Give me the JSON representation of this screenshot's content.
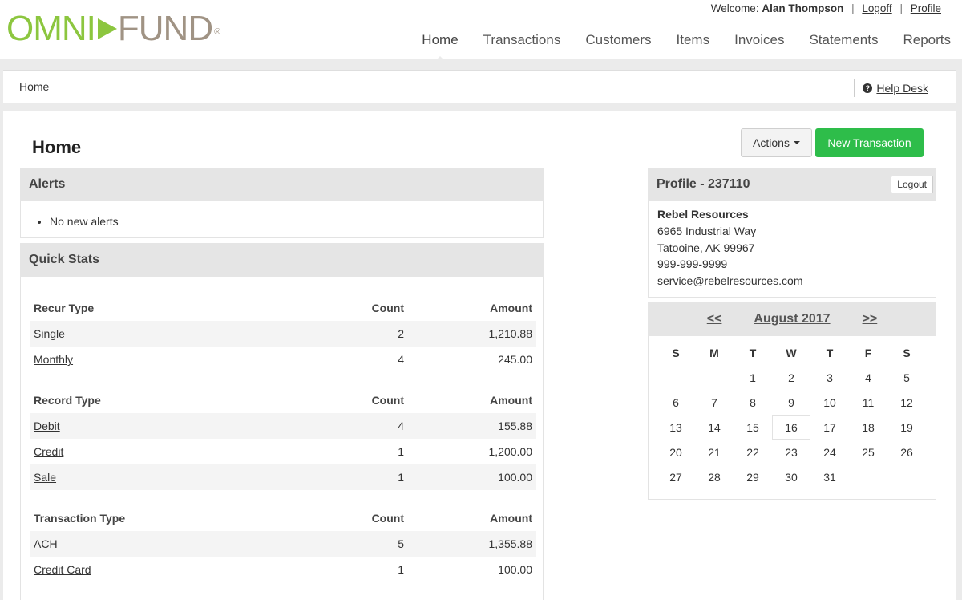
{
  "brand": {
    "left": "OMNI",
    "right": "FUND",
    "reg": "®"
  },
  "user": {
    "welcome": "Welcome:",
    "name": "Alan Thompson",
    "logoff": "Logoff",
    "profile": "Profile",
    "sep": "|"
  },
  "nav": [
    "Home",
    "Transactions",
    "Customers",
    "Items",
    "Invoices",
    "Statements",
    "Reports"
  ],
  "breadcrumb": "Home",
  "help": {
    "icon": "question-circle-icon",
    "label": "Help Desk"
  },
  "page": {
    "title": "Home",
    "actions_label": "Actions",
    "new_label": "New Transaction",
    "new_color": "#2ebd4a"
  },
  "alerts": {
    "title": "Alerts",
    "items": [
      "No new alerts"
    ]
  },
  "quick_stats": {
    "title": "Quick Stats",
    "sections": [
      {
        "header": "Recur Type",
        "count": "Count",
        "amount": "Amount",
        "rows": [
          {
            "label": "Single",
            "count": "2",
            "amount": "1,210.88"
          },
          {
            "label": "Monthly",
            "count": "4",
            "amount": "245.00"
          }
        ]
      },
      {
        "header": "Record Type",
        "count": "Count",
        "amount": "Amount",
        "rows": [
          {
            "label": "Debit",
            "count": "4",
            "amount": "155.88"
          },
          {
            "label": "Credit",
            "count": "1",
            "amount": "1,200.00"
          },
          {
            "label": "Sale",
            "count": "1",
            "amount": "100.00"
          }
        ]
      },
      {
        "header": "Transaction Type",
        "count": "Count",
        "amount": "Amount",
        "rows": [
          {
            "label": "ACH",
            "count": "5",
            "amount": "1,355.88"
          },
          {
            "label": "Credit Card",
            "count": "1",
            "amount": "100.00"
          }
        ]
      }
    ]
  },
  "profile": {
    "title": "Profile - 237110",
    "logout": "Logout",
    "company": "Rebel Resources",
    "address1": "6965 Industrial Way",
    "address2": "Tatooine, AK 99967",
    "phone": "999-999-9999",
    "email": "service@rebelresources.com"
  },
  "calendar": {
    "prev": "<<",
    "next": ">>",
    "month": "August 2017",
    "weekdays": [
      "S",
      "M",
      "T",
      "W",
      "T",
      "F",
      "S"
    ],
    "weeks": [
      [
        "",
        "",
        "1",
        "2",
        "3",
        "4",
        "5"
      ],
      [
        "6",
        "7",
        "8",
        "9",
        "10",
        "11",
        "12"
      ],
      [
        "13",
        "14",
        "15",
        "16",
        "17",
        "18",
        "19"
      ],
      [
        "20",
        "21",
        "22",
        "23",
        "24",
        "25",
        "26"
      ],
      [
        "27",
        "28",
        "29",
        "30",
        "31",
        "",
        ""
      ]
    ],
    "today": "16"
  }
}
